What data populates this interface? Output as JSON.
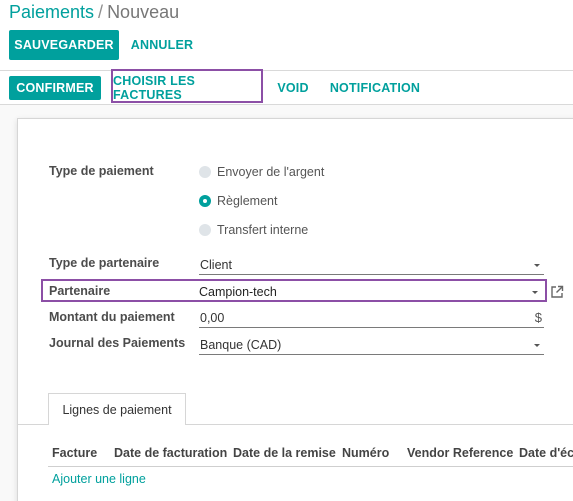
{
  "breadcrumb": {
    "root": "Paiements",
    "separator": "/",
    "current": "Nouveau"
  },
  "toolbar": {
    "save_label": "SAUVEGARDER",
    "discard_label": "ANNULER"
  },
  "statusbar": {
    "confirm_label": "CONFIRMER",
    "choose_invoices_label": "CHOISIR LES FACTURES",
    "void_label": "VOID",
    "notification_label": "NOTIFICATION"
  },
  "form": {
    "payment_type": {
      "label": "Type de paiement",
      "options": [
        "Envoyer de l'argent",
        "Règlement",
        "Transfert interne"
      ],
      "selected": "Règlement"
    },
    "partner_type": {
      "label": "Type de partenaire",
      "value": "Client"
    },
    "partner": {
      "label": "Partenaire",
      "value": "Campion-tech"
    },
    "amount": {
      "label": "Montant du paiement",
      "value": "0,00",
      "currency": "$"
    },
    "journal": {
      "label": "Journal des Paiements",
      "value": "Banque (CAD)"
    }
  },
  "tabs": {
    "payment_lines": "Lignes de paiement"
  },
  "table": {
    "columns": [
      "Facture",
      "Date de facturation",
      "Date de la remise",
      "Numéro",
      "Vendor Reference",
      "Date d'éc"
    ],
    "add_line": "Ajouter une ligne"
  },
  "icons": {
    "external_link": "external-link-icon"
  },
  "colors": {
    "accent": "#00a09d",
    "highlight": "#8c4fa6"
  }
}
